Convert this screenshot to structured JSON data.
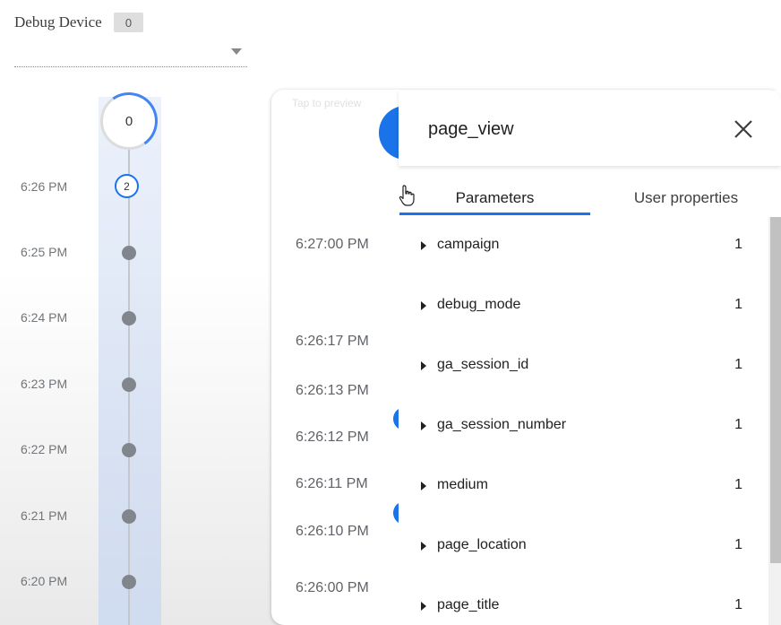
{
  "header": {
    "title": "Debug Device",
    "device_count": "0"
  },
  "timeline": {
    "top_count": "0",
    "current_minute_count": "2",
    "times": [
      "6:26 PM",
      "6:25 PM",
      "6:24 PM",
      "6:23 PM",
      "6:22 PM",
      "6:21 PM",
      "6:20 PM"
    ]
  },
  "stream": {
    "hint": "Tap to preview",
    "times": [
      "6:27:00 PM",
      "6:26:17 PM",
      "6:26:13 PM",
      "6:26:12 PM",
      "6:26:11 PM",
      "6:26:10 PM",
      "6:26:00 PM"
    ]
  },
  "detail": {
    "event_name": "page_view",
    "tabs": {
      "parameters": "Parameters",
      "user_properties": "User properties"
    },
    "parameters": [
      {
        "name": "campaign",
        "count": "1"
      },
      {
        "name": "debug_mode",
        "count": "1"
      },
      {
        "name": "ga_session_id",
        "count": "1"
      },
      {
        "name": "ga_session_number",
        "count": "1"
      },
      {
        "name": "medium",
        "count": "1"
      },
      {
        "name": "page_location",
        "count": "1"
      },
      {
        "name": "page_title",
        "count": "1"
      }
    ]
  },
  "colors": {
    "accent": "#1a73e8",
    "dot": "#80868b"
  },
  "icons": [
    "chevron-down-icon",
    "close-icon",
    "hand-cursor-icon",
    "caret-right-icon"
  ]
}
